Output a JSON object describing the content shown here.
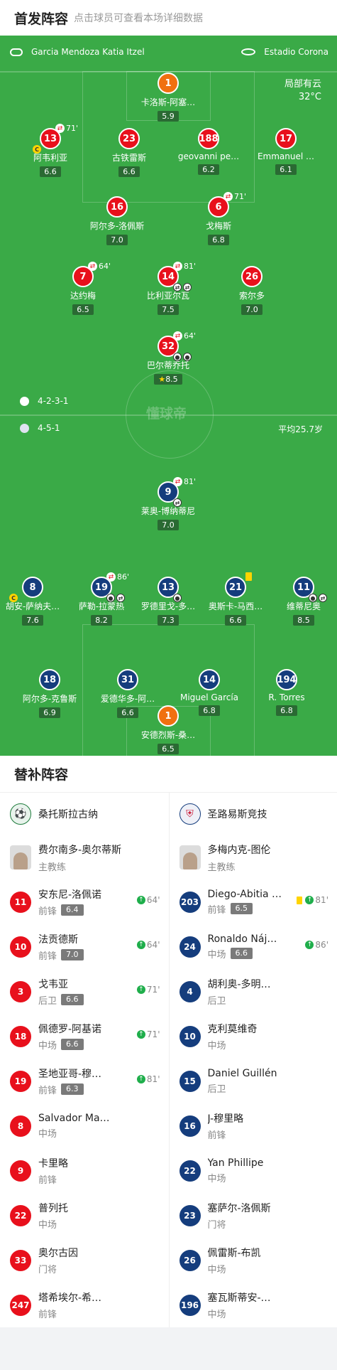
{
  "header": {
    "title": "首发阵容",
    "subtitle": "点击球员可查看本场详细数据"
  },
  "match": {
    "referee": "Garcia Mendoza Katia Itzel",
    "stadium": "Estadio Corona",
    "weather": "局部有云",
    "temperature": "32°C",
    "home_formation": "4-2-3-1",
    "away_formation": "4-5-1",
    "avg_age": "平均25.7岁",
    "watermark": "懂球帝"
  },
  "home_players": [
    {
      "num": "1",
      "name": "卡洛斯-阿塞…",
      "rating": "5.9",
      "gk": true
    },
    {
      "num": "13",
      "name": "阿韦利亚",
      "rating": "6.6",
      "sub": "71'",
      "captain": true
    },
    {
      "num": "23",
      "name": "古铁雷斯",
      "rating": "6.6"
    },
    {
      "num": "188",
      "name": "geovanni pe…",
      "rating": "6.2"
    },
    {
      "num": "17",
      "name": "Emmanuel …",
      "rating": "6.1"
    },
    {
      "num": "16",
      "name": "阿尔多-洛佩斯",
      "rating": "7.0"
    },
    {
      "num": "6",
      "name": "戈梅斯",
      "rating": "6.8",
      "sub": "71'"
    },
    {
      "num": "7",
      "name": "达约梅",
      "rating": "6.5",
      "sub": "64'"
    },
    {
      "num": "14",
      "name": "比利亚尔瓦",
      "rating": "7.5",
      "sub": "81'"
    },
    {
      "num": "26",
      "name": "索尔多",
      "rating": "7.0"
    },
    {
      "num": "32",
      "name": "巴尔蒂乔托",
      "rating": "8.5",
      "sub": "64'",
      "star": true
    }
  ],
  "away_players": [
    {
      "num": "9",
      "name": "莱奥-博纳蒂尼",
      "rating": "7.0",
      "sub": "81'"
    },
    {
      "num": "8",
      "name": "胡安-萨纳夫…",
      "rating": "7.6",
      "captain": true
    },
    {
      "num": "19",
      "name": "萨勒-拉蒙热",
      "rating": "8.2",
      "sub": "86'"
    },
    {
      "num": "13",
      "name": "罗德里戈-多…",
      "rating": "7.3"
    },
    {
      "num": "21",
      "name": "奥斯卡-马西…",
      "rating": "6.6"
    },
    {
      "num": "11",
      "name": "维蒂尼奥",
      "rating": "8.5"
    },
    {
      "num": "18",
      "name": "阿尔多-克鲁斯",
      "rating": "6.9"
    },
    {
      "num": "31",
      "name": "爱德华多-阿…",
      "rating": "6.6"
    },
    {
      "num": "14",
      "name": "Miguel García",
      "rating": "6.8"
    },
    {
      "num": "194",
      "name": "R. Torres",
      "rating": "6.8"
    },
    {
      "num": "1",
      "name": "安德烈斯-桑…",
      "rating": "6.5",
      "gk": true
    }
  ],
  "subs_section": {
    "title": "替补阵容"
  },
  "home_team": {
    "name": "桑托斯拉古纳",
    "coach": {
      "name": "费尔南多-奥尔蒂斯",
      "role": "主教练"
    },
    "subs": [
      {
        "num": "11",
        "name": "安东尼-洛佩诺",
        "pos": "前锋",
        "rating": "6.4",
        "in": "64'"
      },
      {
        "num": "10",
        "name": "法贡德斯",
        "pos": "前锋",
        "rating": "7.0",
        "in": "64'"
      },
      {
        "num": "3",
        "name": "戈韦亚",
        "pos": "后卫",
        "rating": "6.6",
        "in": "71'"
      },
      {
        "num": "18",
        "name": "佩德罗-阿基诺",
        "pos": "中场",
        "rating": "6.6",
        "in": "71'"
      },
      {
        "num": "19",
        "name": "圣地亚哥-穆…",
        "pos": "前锋",
        "rating": "6.3",
        "in": "81'"
      },
      {
        "num": "8",
        "name": "Salvador Mari…",
        "pos": "中场"
      },
      {
        "num": "9",
        "name": "卡里略",
        "pos": "前锋"
      },
      {
        "num": "22",
        "name": "普列托",
        "pos": "中场"
      },
      {
        "num": "33",
        "name": "奥尔古因",
        "pos": "门将"
      },
      {
        "num": "247",
        "name": "塔希埃尔-希…",
        "pos": "前锋"
      }
    ]
  },
  "away_team": {
    "name": "圣路易斯竞技",
    "coach": {
      "name": "多梅内克-图伦",
      "role": "主教练"
    },
    "subs": [
      {
        "num": "203",
        "name": "Diego-Abitia L…",
        "pos": "前锋",
        "rating": "6.5",
        "in": "81'",
        "card": true
      },
      {
        "num": "24",
        "name": "Ronaldo Nájera",
        "pos": "中场",
        "rating": "6.6",
        "in": "86'"
      },
      {
        "num": "4",
        "name": "胡利奥-多明…",
        "pos": "后卫"
      },
      {
        "num": "10",
        "name": "克利莫维奇",
        "pos": "中场"
      },
      {
        "num": "15",
        "name": "Daniel Guillén",
        "pos": "后卫"
      },
      {
        "num": "16",
        "name": "J-穆里略",
        "pos": "前锋"
      },
      {
        "num": "22",
        "name": "Yan Phillipe",
        "pos": "中场"
      },
      {
        "num": "23",
        "name": "塞萨尔-洛佩斯",
        "pos": "门将"
      },
      {
        "num": "26",
        "name": "佩雷斯-布凯",
        "pos": "中场"
      },
      {
        "num": "196",
        "name": "塞瓦斯蒂安-…",
        "pos": "中场"
      }
    ]
  }
}
